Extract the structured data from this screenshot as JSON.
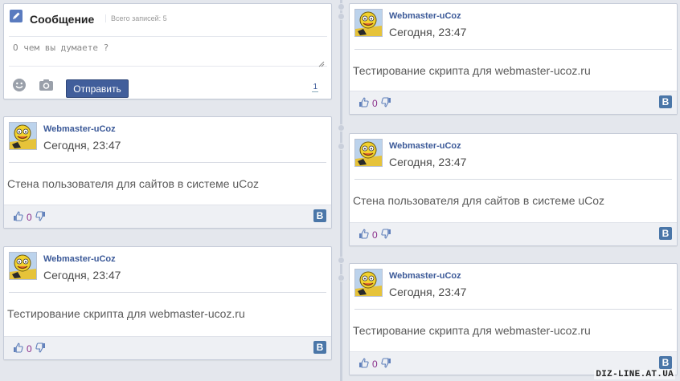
{
  "compose": {
    "title": "Сообщение",
    "count_label": "Всего записей: 5",
    "placeholder": "О чем вы думаете ?",
    "send_label": "Отправить",
    "counter": "1",
    "icons": [
      "pencil-icon",
      "smiley-icon",
      "camera-icon"
    ]
  },
  "posts": [
    {
      "author": "Webmaster-uCoz",
      "date": "Сегодня, 23:47",
      "text": "Тестирование скрипта для webmaster-ucoz.ru",
      "likes": "0",
      "share": "B"
    },
    {
      "author": "Webmaster-uCoz",
      "date": "Сегодня, 23:47",
      "text": "Стена пользователя для сайтов в системе uCoz",
      "likes": "0",
      "share": "B"
    },
    {
      "author": "Webmaster-uCoz",
      "date": "Сегодня, 23:47",
      "text": "Стена пользователя для сайтов в системе uCoz",
      "likes": "0",
      "share": "B"
    },
    {
      "author": "Webmaster-uCoz",
      "date": "Сегодня, 23:47",
      "text": "Тестирование скрипта для webmaster-ucoz.ru",
      "likes": "0",
      "share": "B"
    },
    {
      "author": "Webmaster-uCoz",
      "date": "Сегодня, 23:47",
      "text": "Тестирование скрипта для webmaster-ucoz.ru",
      "likes": "0",
      "share": "B"
    }
  ],
  "watermark": "DIZ-LINE.AT.UA",
  "colors": {
    "accent": "#3b5998",
    "button": "#415e9b",
    "vk": "#4a76a8",
    "like_count": "#8b2f8b",
    "background": "#e4e7ed"
  }
}
